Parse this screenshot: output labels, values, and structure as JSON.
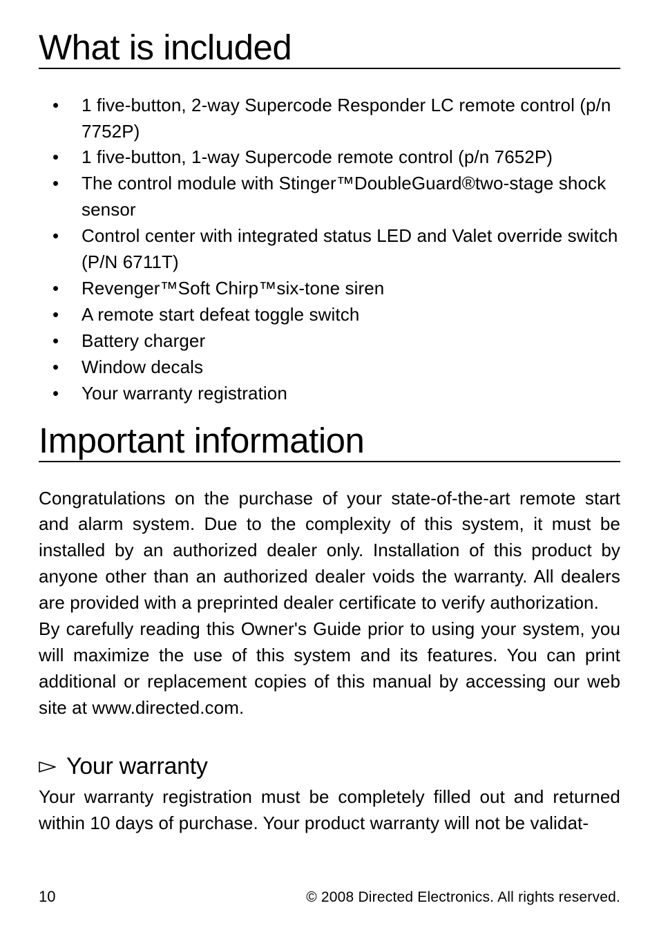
{
  "headings": {
    "included": "What is included",
    "important": "Important information"
  },
  "included_items": [
    "1 five-button, 2-way Supercode Responder LC remote control (p/n 7752P)",
    "1 five-button, 1-way Supercode remote control (p/n 7652P)",
    "The control module with Stinger™DoubleGuard®two-stage shock sensor",
    "Control center with integrated status LED and Valet override switch (P/N 6711T)",
    "Revenger™Soft Chirp™six-tone siren",
    "A remote start defeat toggle switch",
    "Battery charger",
    "Window decals",
    "Your warranty registration"
  ],
  "important": {
    "para1": "Congratulations on the purchase of your state-of-the-art remote start and alarm system. Due to the complexity of this system, it must be installed by an authorized dealer only. Installation of this product by anyone other than an authorized dealer voids the warranty. All dealers are provided with a preprinted dealer certificate to verify authorization.",
    "para2": "By carefully reading this Owner's Guide prior to using your system, you will maximize the use of this system and its features. You can print additional or replacement copies of this manual by accessing our web site at www.directed.com."
  },
  "warranty": {
    "heading": "Your warranty",
    "body": "Your warranty registration must be completely filled out and returned within 10 days of purchase. Your product warranty will not be validat-"
  },
  "footer": {
    "page": "10",
    "copyright": "© 2008 Directed Electronics. All rights reserved."
  }
}
